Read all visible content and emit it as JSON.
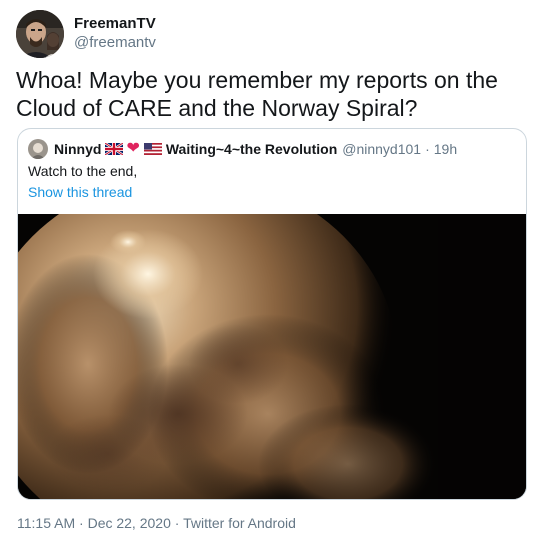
{
  "author": {
    "display_name": "FreemanTV",
    "handle": "@freemantv",
    "avatar_icon": "avatar-icon"
  },
  "tweet": {
    "text": "Whoa! Maybe you remember my reports on the Cloud of CARE and the Norway Spiral?"
  },
  "quoted_tweet": {
    "name": "Ninnyd",
    "name_emoji": [
      "uk-flag-icon",
      "red-heart-icon",
      "us-flag-icon"
    ],
    "name_suffix": "Waiting~4~the Revolution",
    "handle": "@ninnyd101",
    "separator": "·",
    "time": "19h",
    "text": "Watch to the end,",
    "thread_link": "Show this thread",
    "media": "video-of-glowing-cloud-at-night"
  },
  "meta": {
    "time": "11:15 AM",
    "separator1": "·",
    "date": "Dec 22, 2020",
    "separator2": "·",
    "source": "Twitter for Android"
  },
  "colors": {
    "link": "#1b95e0",
    "secondary_text": "#657786",
    "border": "#ccd6dd",
    "heart": "#e0245e"
  }
}
